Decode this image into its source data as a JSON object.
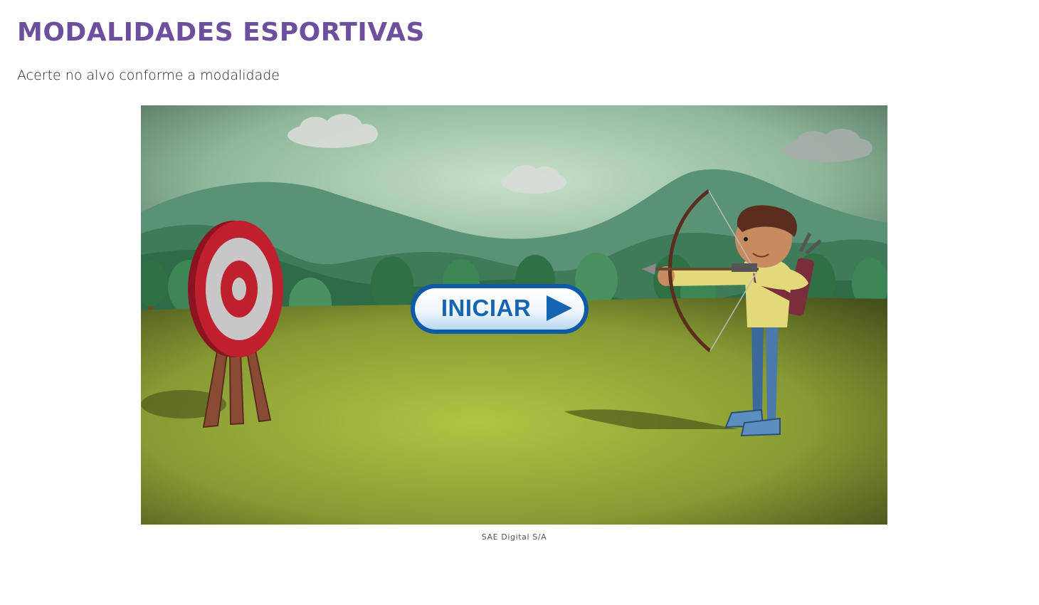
{
  "header": {
    "title": "MODALIDADES ESPORTIVAS",
    "subtitle": "Acerte no alvo conforme a modalidade"
  },
  "game": {
    "start_button_label": "INICIAR",
    "start_button_icon": "play-icon"
  },
  "footer": {
    "credit": "SAE Digital S/A"
  },
  "colors": {
    "title": "#6d4f9d",
    "button_text": "#1565b3",
    "target_red": "#c0202e",
    "grass": "#a9bf3e"
  }
}
